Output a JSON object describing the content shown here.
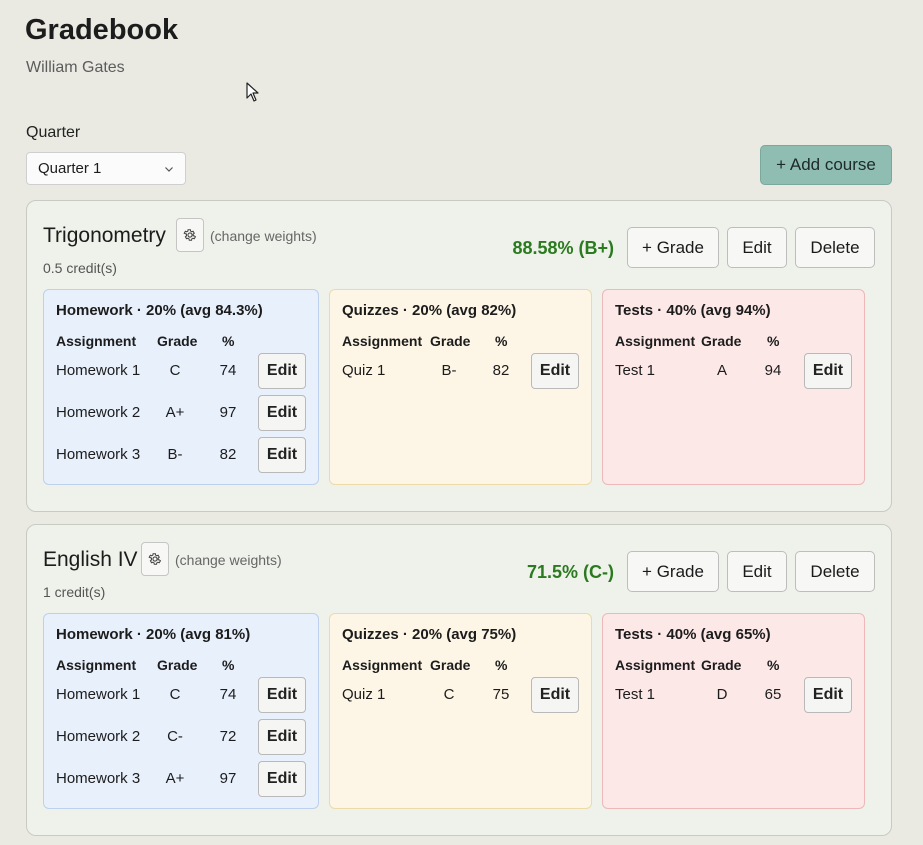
{
  "header": {
    "title": "Gradebook",
    "user": "William Gates"
  },
  "quarter": {
    "label": "Quarter",
    "selected": "Quarter 1"
  },
  "add_course_label": "+ Add course",
  "course_buttons": {
    "add_grade": "+ Grade",
    "edit": "Edit",
    "delete": "Delete"
  },
  "row_edit": "Edit",
  "columns": {
    "assignment": "Assignment",
    "grade": "Grade",
    "percent": "%"
  },
  "change_weights": "(change weights)",
  "colors": {
    "accent": "#8fbdb2",
    "grade_good": "#2b7a1f",
    "homework_bg": "#e8f0fc",
    "quizzes_bg": "#fdf6e6",
    "tests_bg": "#fde8e8"
  },
  "courses": [
    {
      "name": "Trigonometry",
      "credits": "0.5 credit(s)",
      "grade": "88.58% (B+)",
      "categories": [
        {
          "title": "Homework · 20% (avg 84.3%)",
          "rows": [
            {
              "name": "Homework 1",
              "grade": "C",
              "pct": "74"
            },
            {
              "name": "Homework 2",
              "grade": "A+",
              "pct": "97"
            },
            {
              "name": "Homework 3",
              "grade": "B-",
              "pct": "82"
            }
          ]
        },
        {
          "title": "Quizzes · 20% (avg 82%)",
          "rows": [
            {
              "name": "Quiz 1",
              "grade": "B-",
              "pct": "82"
            }
          ]
        },
        {
          "title": "Tests · 40% (avg 94%)",
          "rows": [
            {
              "name": "Test 1",
              "grade": "A",
              "pct": "94"
            }
          ]
        }
      ]
    },
    {
      "name": "English IV",
      "credits": "1 credit(s)",
      "grade": "71.5% (C-)",
      "categories": [
        {
          "title": "Homework · 20% (avg 81%)",
          "rows": [
            {
              "name": "Homework 1",
              "grade": "C",
              "pct": "74"
            },
            {
              "name": "Homework 2",
              "grade": "C-",
              "pct": "72"
            },
            {
              "name": "Homework 3",
              "grade": "A+",
              "pct": "97"
            }
          ]
        },
        {
          "title": "Quizzes · 20% (avg 75%)",
          "rows": [
            {
              "name": "Quiz 1",
              "grade": "C",
              "pct": "75"
            }
          ]
        },
        {
          "title": "Tests · 40% (avg 65%)",
          "rows": [
            {
              "name": "Test 1",
              "grade": "D",
              "pct": "65"
            }
          ]
        }
      ]
    }
  ]
}
